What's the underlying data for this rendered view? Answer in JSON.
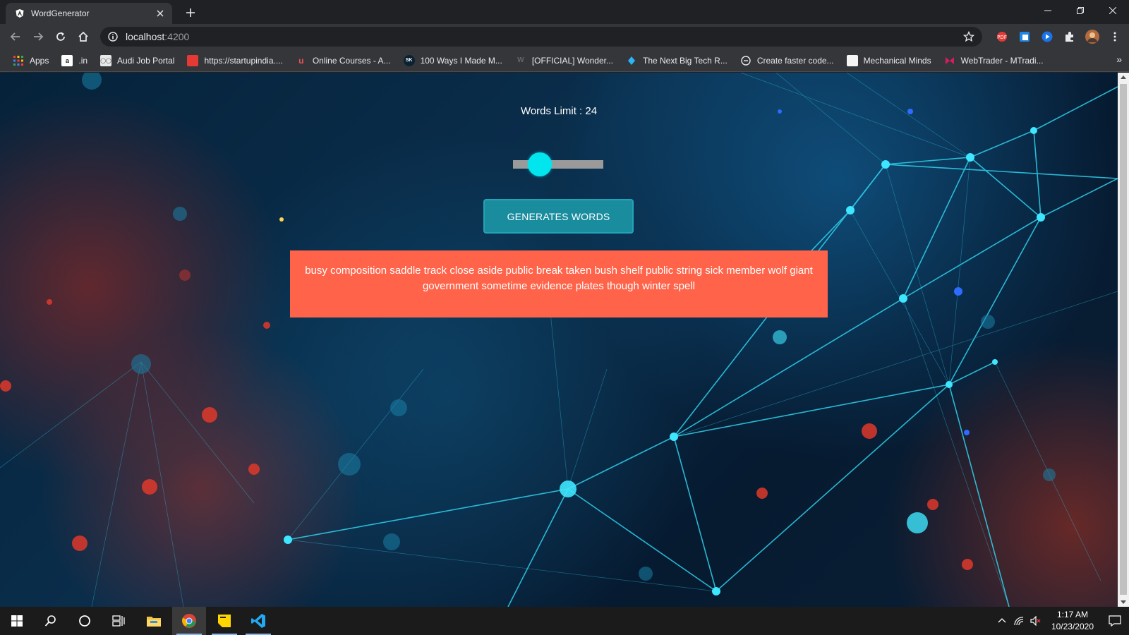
{
  "browser": {
    "tab": {
      "title": "WordGenerator",
      "favicon": "angular-logo-icon"
    },
    "address": {
      "host": "localhost",
      "port": ":4200"
    },
    "bookmarks": [
      {
        "label": "Apps",
        "icon": "apps-grid-icon"
      },
      {
        "label": ".in",
        "icon": "amazon-icon"
      },
      {
        "label": "Audi Job Portal",
        "icon": "audi-icon"
      },
      {
        "label": "https://startupindia....",
        "icon": "startupindia-icon"
      },
      {
        "label": "Online Courses - A...",
        "icon": "udemy-icon"
      },
      {
        "label": "100 Ways I Made M...",
        "icon": "sk-icon"
      },
      {
        "label": "[OFFICIAL] Wonder...",
        "icon": "wondershare-icon"
      },
      {
        "label": "The Next Big Tech R...",
        "icon": "tech-icon"
      },
      {
        "label": "Create faster code...",
        "icon": "code-icon"
      },
      {
        "label": "Mechanical Minds",
        "icon": "page-icon"
      },
      {
        "label": "WebTrader - MTradi...",
        "icon": "webtrader-icon"
      }
    ],
    "bookmarks_more": "»"
  },
  "app": {
    "words_limit_label": "Words Limit : 24",
    "slider_fraction": 0.3,
    "generate_button": "GENERATES WORDS",
    "generated_text": "busy composition saddle track close aside public break taken bush shelf public string sick member wolf giant government sometime evidence plates though winter spell",
    "colors": {
      "slider_thumb": "#00e5ee",
      "button_bg": "#198c9e",
      "result_bg": "#ff6349"
    }
  },
  "taskbar": {
    "time": "1:17 AM",
    "date": "10/23/2020"
  }
}
